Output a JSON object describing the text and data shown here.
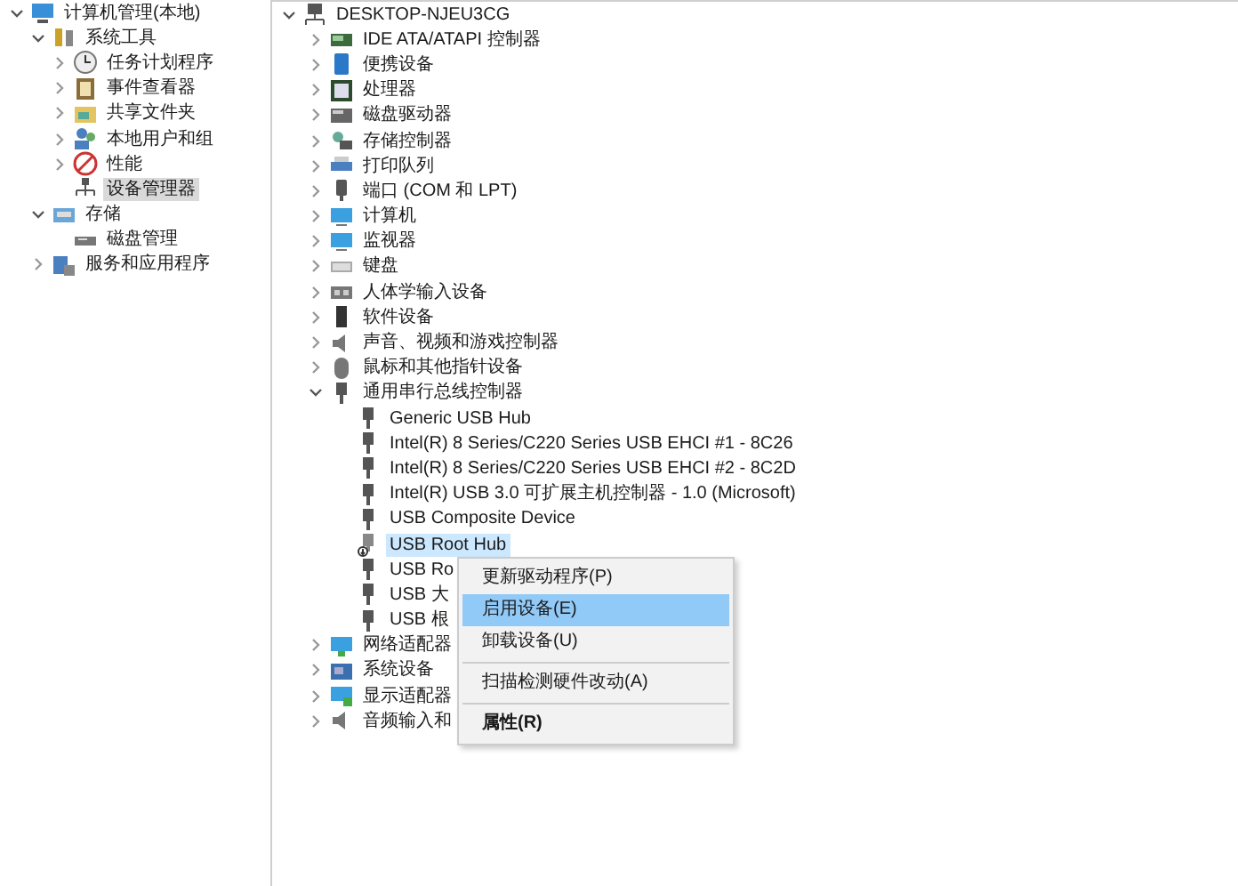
{
  "left_tree": [
    {
      "label": "计算机管理(本地)",
      "expanded": true,
      "selected": false,
      "children": [
        {
          "label": "系统工具",
          "expanded": true,
          "selected": false,
          "children": [
            {
              "label": "任务计划程序",
              "expanded": false,
              "selected": false
            },
            {
              "label": "事件查看器",
              "expanded": false,
              "selected": false
            },
            {
              "label": "共享文件夹",
              "expanded": false,
              "selected": false
            },
            {
              "label": "本地用户和组",
              "expanded": false,
              "selected": false
            },
            {
              "label": "性能",
              "expanded": false,
              "selected": false
            },
            {
              "label": "设备管理器",
              "selected": true
            }
          ]
        },
        {
          "label": "存储",
          "expanded": true,
          "selected": false,
          "children": [
            {
              "label": "磁盘管理",
              "selected": false
            }
          ]
        },
        {
          "label": "服务和应用程序",
          "expanded": false,
          "selected": false
        }
      ]
    }
  ],
  "device_tree": [
    {
      "label": "DESKTOP-NJEU3CG",
      "expanded": true,
      "selected": false,
      "children": [
        {
          "label": "IDE ATA/ATAPI 控制器",
          "expanded": false,
          "selected": false
        },
        {
          "label": "便携设备",
          "expanded": false,
          "selected": false
        },
        {
          "label": "处理器",
          "expanded": false,
          "selected": false
        },
        {
          "label": "磁盘驱动器",
          "expanded": false,
          "selected": false
        },
        {
          "label": "存储控制器",
          "expanded": false,
          "selected": false
        },
        {
          "label": "打印队列",
          "expanded": false,
          "selected": false
        },
        {
          "label": "端口 (COM 和 LPT)",
          "expanded": false,
          "selected": false
        },
        {
          "label": "计算机",
          "expanded": false,
          "selected": false
        },
        {
          "label": "监视器",
          "expanded": false,
          "selected": false
        },
        {
          "label": "键盘",
          "expanded": false,
          "selected": false
        },
        {
          "label": "人体学输入设备",
          "expanded": false,
          "selected": false
        },
        {
          "label": "软件设备",
          "expanded": false,
          "selected": false
        },
        {
          "label": "声音、视频和游戏控制器",
          "expanded": false,
          "selected": false
        },
        {
          "label": "鼠标和其他指针设备",
          "expanded": false,
          "selected": false
        },
        {
          "label": "通用串行总线控制器",
          "expanded": true,
          "selected": false,
          "children": [
            {
              "label": "Generic USB Hub",
              "selected": false,
              "disabled": false
            },
            {
              "label": "Intel(R) 8 Series/C220 Series USB EHCI #1 - 8C26",
              "selected": false,
              "disabled": false
            },
            {
              "label": "Intel(R) 8 Series/C220 Series USB EHCI #2 - 8C2D",
              "selected": false,
              "disabled": false
            },
            {
              "label": "Intel(R) USB 3.0 可扩展主机控制器 - 1.0 (Microsoft)",
              "selected": false,
              "disabled": false
            },
            {
              "label": "USB Composite Device",
              "selected": false,
              "disabled": false
            },
            {
              "label": "USB Root Hub",
              "selected": true,
              "disabled": true
            },
            {
              "label": "USB Ro",
              "selected": false,
              "disabled": false
            },
            {
              "label": "USB 大",
              "selected": false,
              "disabled": false
            },
            {
              "label": "USB 根",
              "selected": false,
              "disabled": false
            }
          ]
        },
        {
          "label": "网络适配器",
          "expanded": false,
          "selected": false
        },
        {
          "label": "系统设备",
          "expanded": false,
          "selected": false
        },
        {
          "label": "显示适配器",
          "expanded": false,
          "selected": false
        },
        {
          "label": "音频输入和",
          "expanded": false,
          "selected": false
        }
      ]
    }
  ],
  "context_menu": [
    {
      "kind": "item",
      "label": "更新驱动程序(P)",
      "selected": false
    },
    {
      "kind": "item",
      "label": "启用设备(E)",
      "selected": true
    },
    {
      "kind": "item",
      "label": "卸载设备(U)",
      "selected": false
    },
    {
      "kind": "separator"
    },
    {
      "kind": "item",
      "label": "扫描检测硬件改动(A)",
      "selected": false
    },
    {
      "kind": "separator"
    },
    {
      "kind": "bold",
      "label": "属性(R)",
      "selected": false
    }
  ]
}
